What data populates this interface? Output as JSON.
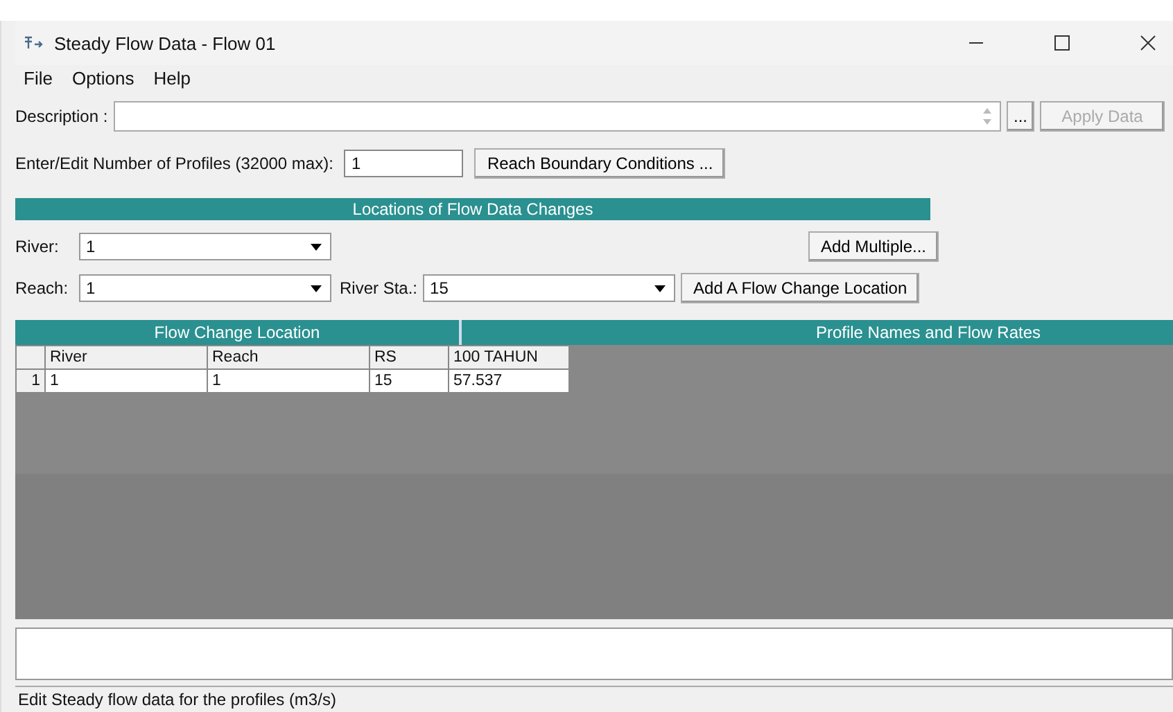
{
  "window": {
    "title": "Steady Flow Data - Flow 01"
  },
  "menu": [
    "File",
    "Options",
    "Help"
  ],
  "description": {
    "label": "Description :",
    "more_button": "...",
    "apply_button": {
      "label": "Apply Data",
      "disabled": true
    }
  },
  "profiles": {
    "label": "Enter/Edit Number of Profiles (32000 max):",
    "value": "1",
    "boundary_button": "Reach Boundary Conditions ..."
  },
  "locations": {
    "title": "Locations of Flow Data Changes",
    "river_label": "River:",
    "river_value": "1",
    "reach_label": "Reach:",
    "reach_value": "1",
    "station_label": "River Sta.:",
    "station_value": "15",
    "add_multiple_button": "Add Multiple...",
    "add_location_button": "Add A Flow Change Location"
  },
  "table": {
    "left_heading": "Flow Change Location",
    "right_heading": "Profile Names and Flow Rates",
    "columns": [
      "River",
      "Reach",
      "RS",
      "100 TAHUN"
    ],
    "rows": [
      {
        "number": "1",
        "cells": [
          "1",
          "1",
          "15",
          "57.537"
        ]
      }
    ]
  },
  "status_bar": "Edit Steady flow data for the profiles (m3/s)"
}
